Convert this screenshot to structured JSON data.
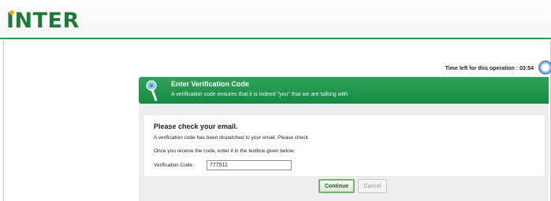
{
  "brand": {
    "logo_text": "INTER"
  },
  "timer": {
    "label": "Time left for this operation :",
    "value": "03:54"
  },
  "banner": {
    "title": "Enter Verification Code",
    "subtitle": "A verification code ensures that it is indeed \"you\" that we are talking with"
  },
  "card": {
    "title": "Please check your email.",
    "line1": "A verification code has been dispatched to your email. Please check.",
    "line2": "Once you receive the code, enter it in the textbox given below:",
    "code_label": "Verification Code :",
    "code_value": "777511"
  },
  "buttons": {
    "continue": "Continue",
    "cancel": "Cancel"
  },
  "colors": {
    "brand_green": "#1f7a3a",
    "banner_green": "#2fa25a",
    "accent_orange": "#f2a900"
  },
  "icons": {
    "timer": "clock-icon",
    "banner": "key-icon"
  }
}
